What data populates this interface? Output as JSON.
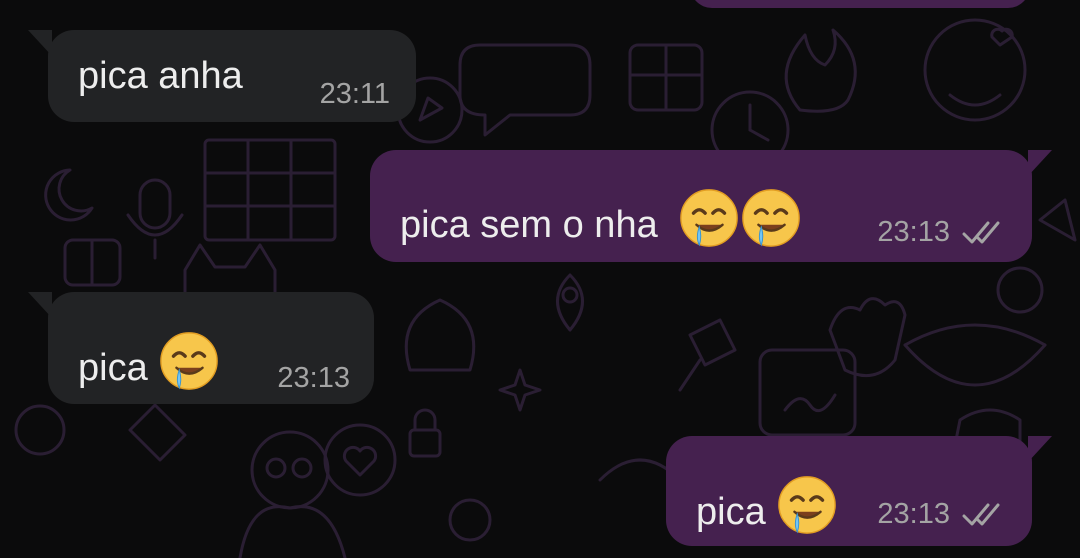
{
  "wallpaper": {
    "icon": "doodle-pattern",
    "color": "#2a1e33"
  },
  "colors": {
    "background": "#0b0b0c",
    "incoming_bubble": "#222325",
    "outgoing_bubble": "#45214f",
    "text": "#ededed",
    "timestamp": "#a4a4a4",
    "read_ticks": "#a4a4a4"
  },
  "messages": [
    {
      "direction": "incoming",
      "text": "pica anha",
      "emoji": [],
      "time": "23:11"
    },
    {
      "direction": "outgoing",
      "text": "pica sem o nha",
      "emoji": [
        "drooling-face",
        "drooling-face"
      ],
      "time": "23:13",
      "status": "double-check-read-icon"
    },
    {
      "direction": "incoming",
      "text": "pica",
      "emoji": [
        "drooling-face"
      ],
      "time": "23:13"
    },
    {
      "direction": "outgoing",
      "text": "pica",
      "emoji": [
        "drooling-face"
      ],
      "time": "23:13",
      "status": "double-check-read-icon"
    }
  ]
}
